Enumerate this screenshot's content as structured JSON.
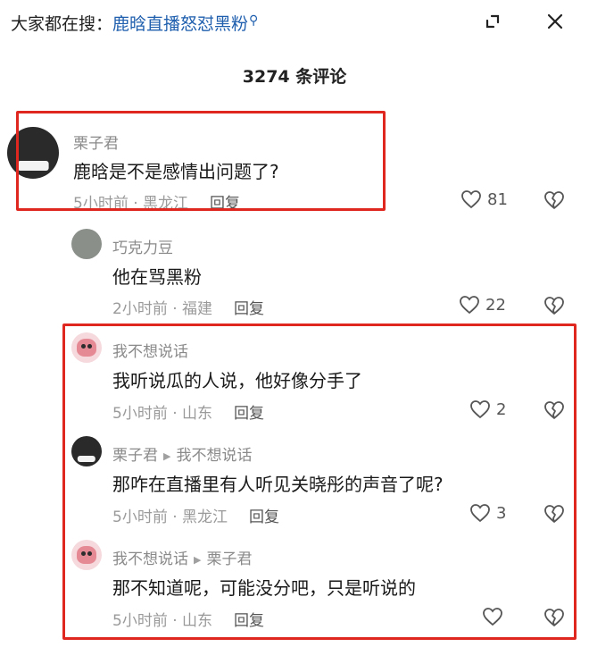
{
  "search": {
    "prefix": "大家都在搜：",
    "query": "鹿晗直播怒怼黑粉",
    "icon": "search-icon"
  },
  "header": {
    "expand_icon": "expand-icon",
    "close_icon": "close-icon",
    "comment_count_title": "3274 条评论"
  },
  "highlight_color": "#e0271f",
  "comments": [
    {
      "name": "栗子君",
      "text": "鹿晗是不是感情出问题了?",
      "time": "5小时前 · 黑龙江",
      "reply_label": "回复",
      "likes": "81"
    },
    {
      "name": "巧克力豆",
      "text": "他在骂黑粉",
      "time": "2小时前 · 福建",
      "reply_label": "回复",
      "likes": "22"
    },
    {
      "name": "我不想说话",
      "text": "我听说瓜的人说，他好像分手了",
      "time": "5小时前 · 山东",
      "reply_label": "回复",
      "likes": "2"
    },
    {
      "name": "栗子君",
      "reply_to": "我不想说话",
      "text": "那咋在直播里有人听见关晓彤的声音了呢?",
      "time": "5小时前 · 黑龙江",
      "reply_label": "回复",
      "likes": "3"
    },
    {
      "name": "我不想说话",
      "reply_to": "栗子君",
      "text": "那不知道呢，可能没分吧，只是听说的",
      "time": "5小时前 · 山东",
      "reply_label": "回复",
      "likes": ""
    }
  ]
}
